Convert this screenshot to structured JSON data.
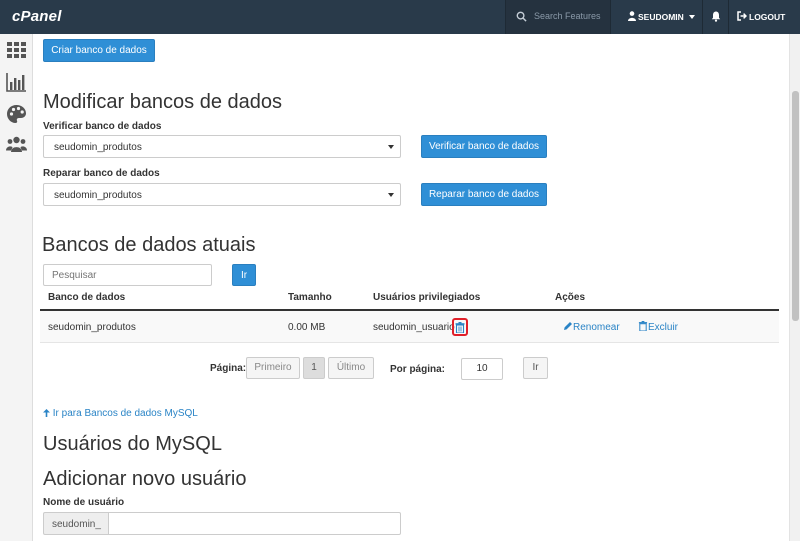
{
  "topbar": {
    "logo": "cPanel",
    "search_placeholder": "Search Features",
    "username": "SEUDOMIN",
    "logout_label": "LOGOUT"
  },
  "sidebar": {
    "items": [
      {
        "icon": "grid-icon"
      },
      {
        "icon": "bar-chart-icon"
      },
      {
        "icon": "palette-icon"
      },
      {
        "icon": "users-icon"
      }
    ]
  },
  "create_db_button": "Criar banco de dados",
  "modify": {
    "title": "Modificar bancos de dados",
    "check_label": "Verificar banco de dados",
    "check_selected": "seudomin_produtos",
    "check_button": "Verificar banco de dados",
    "repair_label": "Reparar banco de dados",
    "repair_selected": "seudomin_produtos",
    "repair_button": "Reparar banco de dados"
  },
  "current": {
    "title": "Bancos de dados atuais",
    "search_placeholder": "Pesquisar",
    "search_button": "Ir",
    "columns": [
      "Banco de dados",
      "Tamanho",
      "Usuários privilegiados",
      "Ações"
    ],
    "rows": [
      {
        "database": "seudomin_produtos",
        "size": "0.00 MB",
        "user": "seudomin_usuario",
        "rename": "Renomear",
        "delete": "Excluir"
      }
    ],
    "pagination": {
      "page_label": "Página:",
      "first": "Primeiro",
      "current_page": "1",
      "last": "Último",
      "per_page_label": "Por página:",
      "per_page_value": "10",
      "go_button": "Ir"
    },
    "back_link": "Ir para Bancos de dados MySQL"
  },
  "mysql_users": {
    "title": "Usuários do MySQL",
    "add_title": "Adicionar novo usuário",
    "username_label": "Nome de usuário",
    "prefix": "seudomin_"
  },
  "colors": {
    "topbar": "#293a4a",
    "primary": "#2f8fd6",
    "link": "#2a84c6",
    "highlight": "#e0202a"
  }
}
